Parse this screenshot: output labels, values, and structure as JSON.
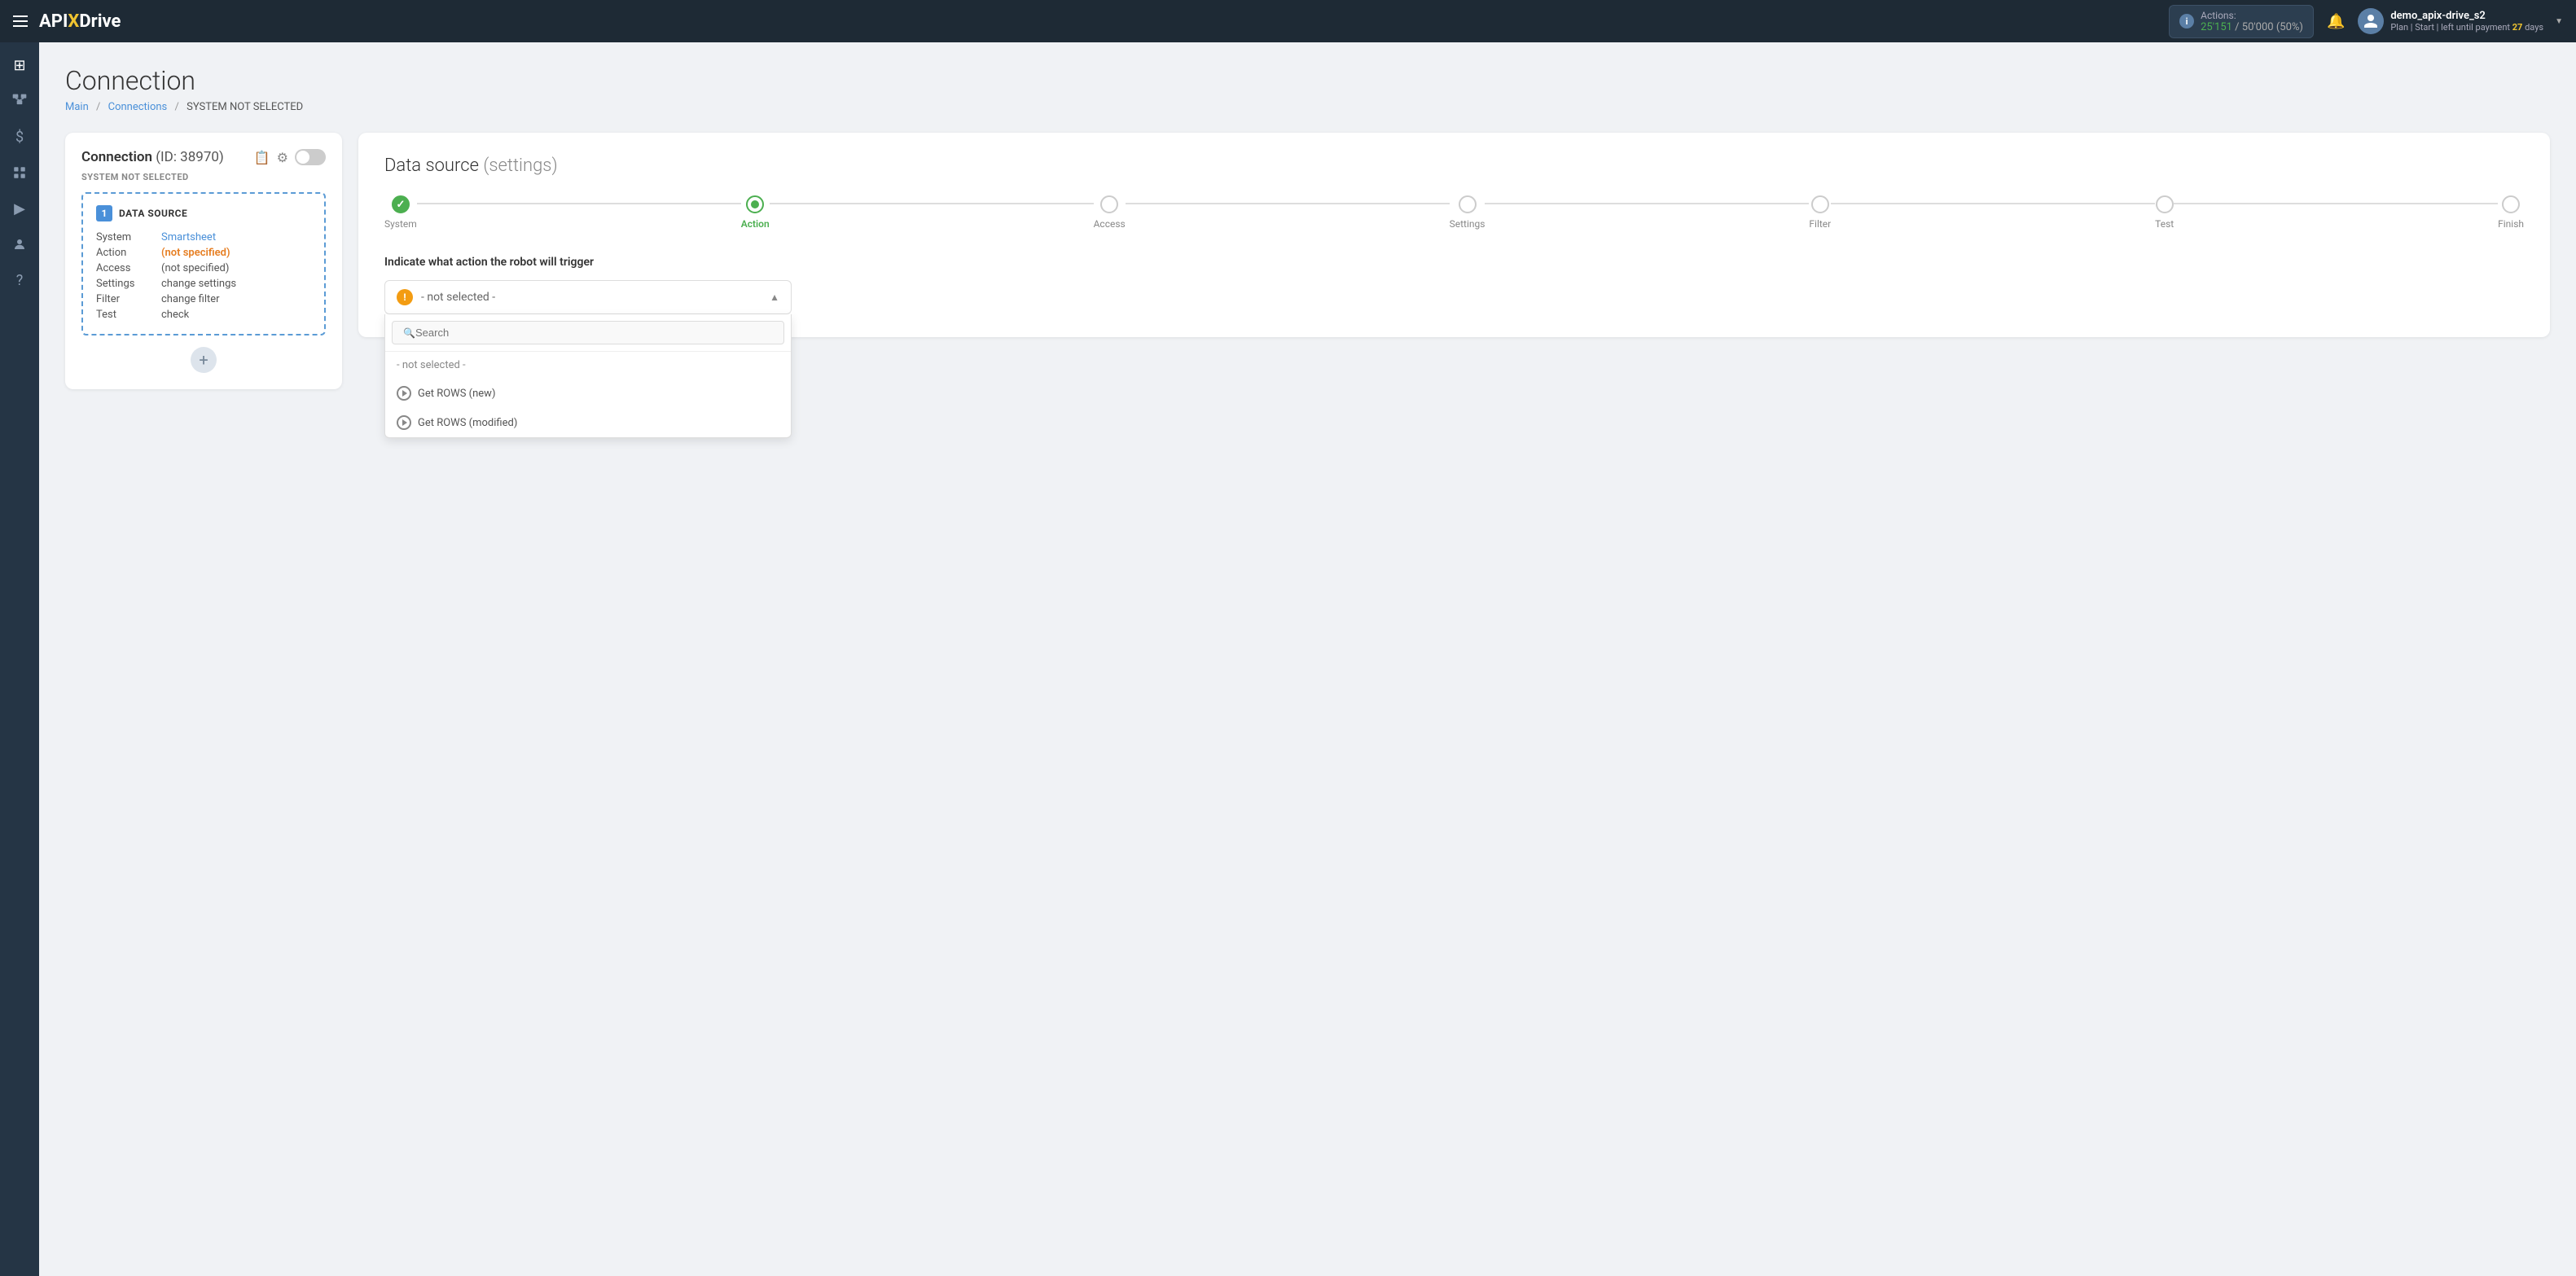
{
  "navbar": {
    "hamburger_label": "menu",
    "logo_prefix": "API",
    "logo_x": "X",
    "logo_suffix": "Drive",
    "actions_label": "Actions:",
    "actions_used": "25'151",
    "actions_total": "50'000",
    "actions_pct": "50%",
    "bell_label": "notifications",
    "user_name": "demo_apix-drive_s2",
    "plan_label": "Plan",
    "start_label": "Start",
    "payment_label": "left until payment",
    "days": "27",
    "days_unit": "days",
    "chevron": "›"
  },
  "sidebar": {
    "items": [
      {
        "icon": "⊞",
        "name": "dashboard",
        "label": "Dashboard"
      },
      {
        "icon": "⋮⋮",
        "name": "connections",
        "label": "Connections"
      },
      {
        "icon": "$",
        "name": "billing",
        "label": "Billing"
      },
      {
        "icon": "⊟",
        "name": "templates",
        "label": "Templates"
      },
      {
        "icon": "▶",
        "name": "tutorials",
        "label": "Tutorials"
      },
      {
        "icon": "👤",
        "name": "account",
        "label": "Account"
      },
      {
        "icon": "?",
        "name": "help",
        "label": "Help"
      }
    ]
  },
  "page": {
    "title": "Connection",
    "breadcrumb": {
      "main": "Main",
      "connections": "Connections",
      "current": "SYSTEM NOT SELECTED"
    }
  },
  "connection_card": {
    "title": "Connection",
    "id_label": "(ID: 38970)",
    "copy_icon": "📋",
    "gear_icon": "⚙",
    "system_not_selected": "SYSTEM NOT SELECTED",
    "ds_number": "1",
    "ds_label": "DATA SOURCE",
    "table": [
      {
        "key": "System",
        "value": "Smartsheet",
        "link": true
      },
      {
        "key": "Action",
        "value": "(not specified)",
        "link": true,
        "warning": true
      },
      {
        "key": "Access",
        "value": "(not specified)",
        "link": false,
        "warning": true
      },
      {
        "key": "Settings",
        "value": "change settings",
        "link": false
      },
      {
        "key": "Filter",
        "value": "change filter",
        "link": false
      },
      {
        "key": "Test",
        "value": "check",
        "link": false
      }
    ],
    "add_btn": "+"
  },
  "settings_card": {
    "title": "Data source",
    "title_sub": "(settings)",
    "steps": [
      {
        "id": "system",
        "label": "System",
        "state": "done"
      },
      {
        "id": "action",
        "label": "Action",
        "state": "active"
      },
      {
        "id": "access",
        "label": "Access",
        "state": "none"
      },
      {
        "id": "settings",
        "label": "Settings",
        "state": "none"
      },
      {
        "id": "filter",
        "label": "Filter",
        "state": "none"
      },
      {
        "id": "test",
        "label": "Test",
        "state": "none"
      },
      {
        "id": "finish",
        "label": "Finish",
        "state": "none"
      }
    ],
    "indicate_label": "Indicate what action the robot will trigger",
    "dropdown": {
      "selected": "- not selected -",
      "placeholder": "Search",
      "options": [
        {
          "id": "not_selected",
          "label": "- not selected -",
          "type": "none"
        },
        {
          "id": "get_rows_new",
          "label": "Get ROWS (new)",
          "type": "play"
        },
        {
          "id": "get_rows_modified",
          "label": "Get ROWS (modified)",
          "type": "play"
        }
      ]
    }
  }
}
